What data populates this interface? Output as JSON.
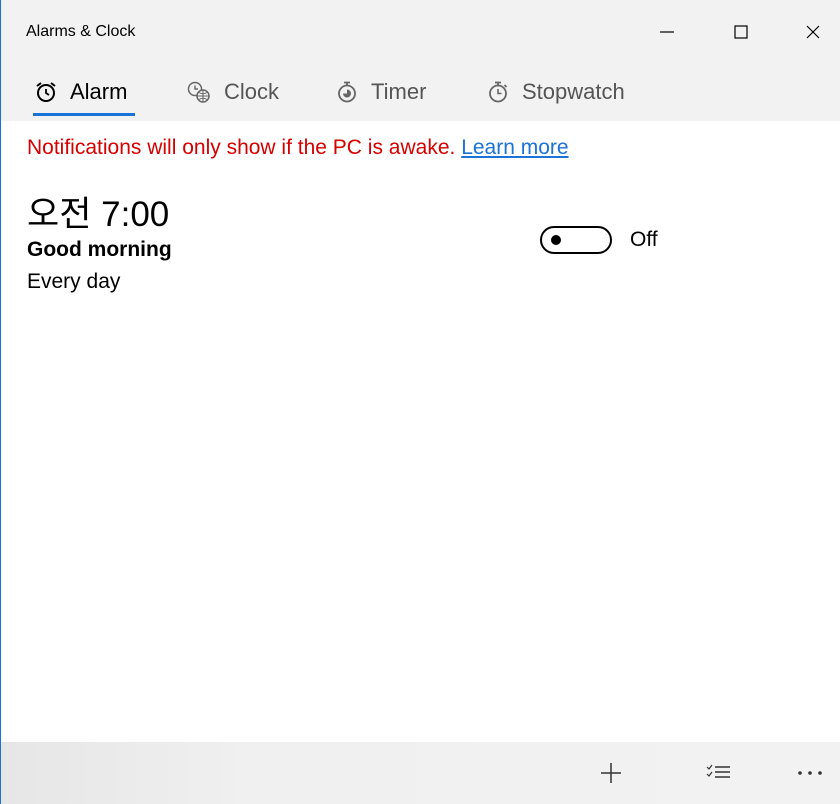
{
  "window": {
    "title": "Alarms & Clock",
    "controls": [
      "minimize-icon",
      "maximize-icon",
      "close-icon"
    ]
  },
  "tabs": [
    {
      "label": "Alarm",
      "icon": "alarm-clock-icon",
      "active": true
    },
    {
      "label": "Clock",
      "icon": "world-clock-icon",
      "active": false
    },
    {
      "label": "Timer",
      "icon": "timer-icon",
      "active": false
    },
    {
      "label": "Stopwatch",
      "icon": "stopwatch-icon",
      "active": false
    }
  ],
  "notice": {
    "text": "Notifications will only show if the PC is awake.",
    "link": "Learn more"
  },
  "alarms": [
    {
      "time": "오전 7:00",
      "name": "Good morning",
      "repeat": "Every day",
      "state_label": "Off",
      "enabled": false
    }
  ],
  "command_bar": {
    "buttons": [
      "add-icon",
      "select-icon",
      "more-icon"
    ]
  },
  "colors": {
    "accent": "#1a73d9",
    "notice": "#d50000",
    "chrome": "#f2f2f2"
  }
}
